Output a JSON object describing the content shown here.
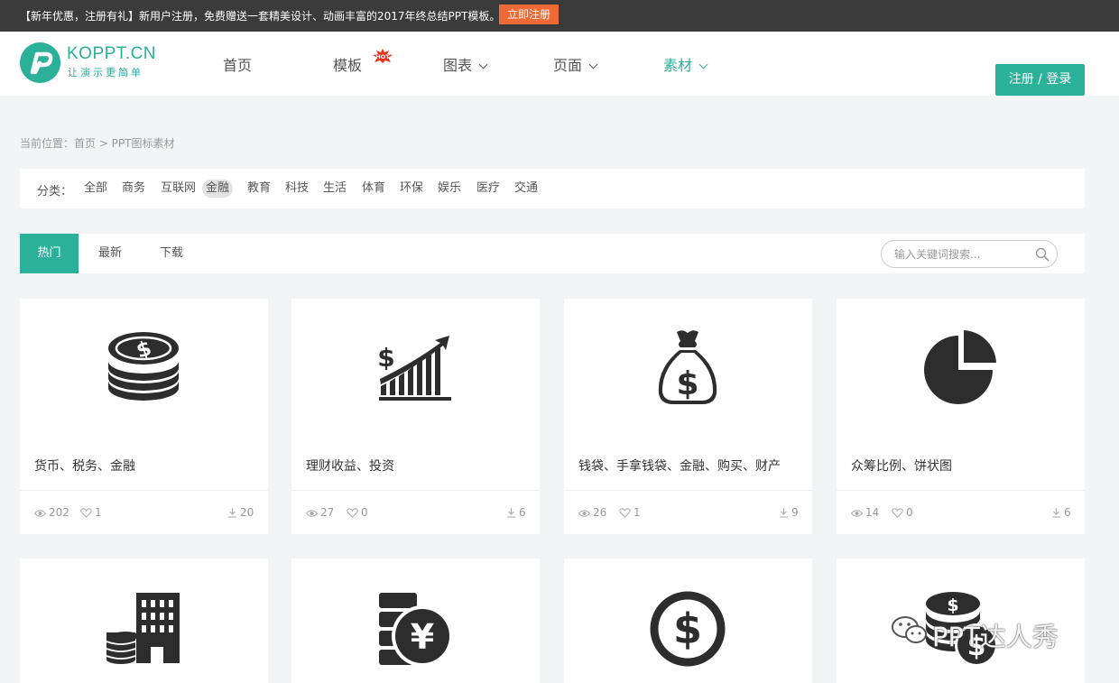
{
  "promo": {
    "text": "【新年优惠，注册有礼】新用户注册，免费赠送一套精美设计、动画丰富的2017年终总结PPT模板。",
    "button": "立即注册"
  },
  "logo": {
    "title": "KOPPT.CN",
    "slogan": "让演示更简单"
  },
  "nav": {
    "items": [
      {
        "label": "首页"
      },
      {
        "label": "模板",
        "badge": "HOT"
      },
      {
        "label": "图表"
      },
      {
        "label": "页面"
      },
      {
        "label": "素材"
      }
    ],
    "active": "素材"
  },
  "auth_button": "注册 / 登录",
  "breadcrumb": "当前位置：首页 > PPT图标素材",
  "categories": {
    "label": "分类：",
    "items": [
      "全部",
      "商务",
      "互联网",
      "金融",
      "教育",
      "科技",
      "生活",
      "体育",
      "环保",
      "娱乐",
      "医疗",
      "交通"
    ],
    "active": "金融"
  },
  "tabs": {
    "items": [
      "热门",
      "最新",
      "下载"
    ],
    "active": "热门"
  },
  "search": {
    "placeholder": "输入关键词搜索..."
  },
  "cards": [
    {
      "icon": "coin-stack-dollar-icon",
      "title": "货币、税务、金融",
      "views": "202",
      "likes": "1",
      "downloads": "20"
    },
    {
      "icon": "rising-bar-chart-dollar-icon",
      "title": "理财收益、投资",
      "views": "27",
      "likes": "0",
      "downloads": "6"
    },
    {
      "icon": "money-bag-icon",
      "title": "钱袋、手拿钱袋、金融、购买、财产",
      "views": "26",
      "likes": "1",
      "downloads": "9"
    },
    {
      "icon": "pie-chart-icon",
      "title": "众筹比例、饼状图",
      "views": "14",
      "likes": "0",
      "downloads": "6"
    },
    {
      "icon": "bank-building-coins-icon"
    },
    {
      "icon": "yen-coin-stack-icon"
    },
    {
      "icon": "dollar-circle-icon"
    },
    {
      "icon": "dollar-coins-icon"
    }
  ],
  "watermark": "PPT达人秀",
  "colors": {
    "accent": "#2bb09a",
    "promo_bg": "#3b3b3b",
    "promo_button": "#f06a35",
    "icon": "#2d2d2d"
  }
}
